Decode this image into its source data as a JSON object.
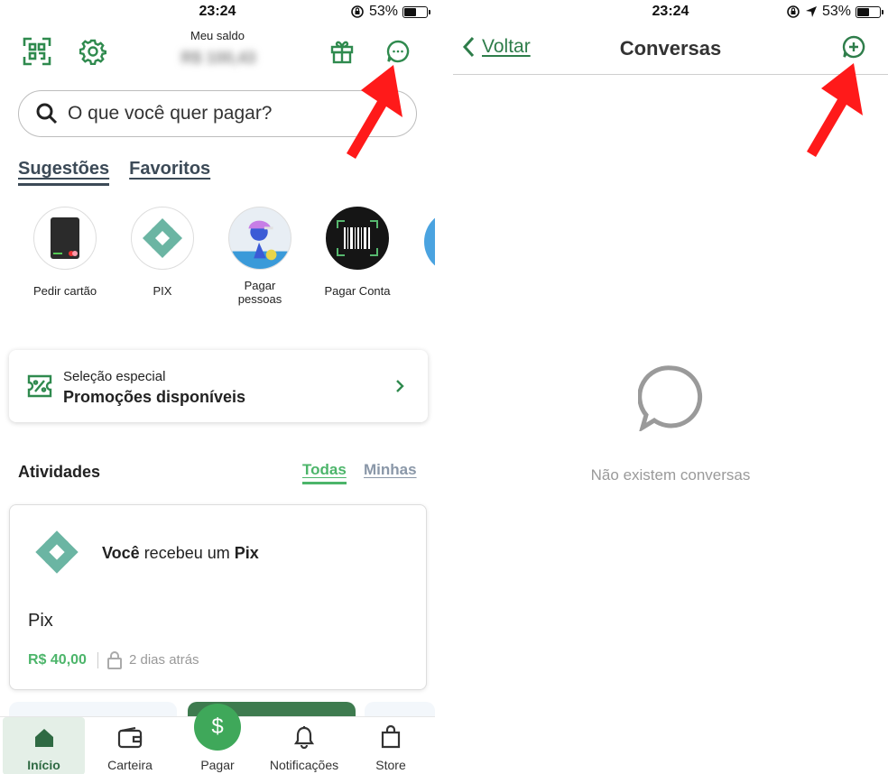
{
  "left": {
    "status": {
      "time": "23:24",
      "battery": "53%"
    },
    "header": {
      "saldo_label": "Meu saldo",
      "saldo_value": "R$ 100,43"
    },
    "search": {
      "placeholder": "O que você quer pagar?"
    },
    "tabs": [
      {
        "label": "Sugestões"
      },
      {
        "label": "Favoritos"
      }
    ],
    "suggestions": [
      {
        "label": "Pedir cartão",
        "icon": "card-icon"
      },
      {
        "label": "PIX",
        "icon": "pix-icon"
      },
      {
        "label": "Pagar pessoas",
        "icon": "person-icon"
      },
      {
        "label": "Pagar Conta",
        "icon": "barcode-icon"
      }
    ],
    "promo": {
      "line1": "Seleção especial",
      "line2": "Promoções disponíveis"
    },
    "activities": {
      "title": "Atividades",
      "tabs": [
        {
          "label": "Todas"
        },
        {
          "label": "Minhas"
        }
      ],
      "card": {
        "msg_bold1": "Você",
        "msg_mid": " recebeu um ",
        "msg_bold2": "Pix",
        "type": "Pix",
        "amount": "R$ 40,00",
        "time": "2 dias atrás"
      }
    },
    "nav": [
      {
        "label": "Início"
      },
      {
        "label": "Carteira"
      },
      {
        "label": "Pagar"
      },
      {
        "label": "Notificações"
      },
      {
        "label": "Store"
      }
    ],
    "colors": {
      "accent": "#3fa85a",
      "dark_green": "#2e7d4a",
      "arrow": "#ff1a1a"
    }
  },
  "right": {
    "status": {
      "time": "23:24",
      "battery": "53%"
    },
    "header": {
      "back_label": "Voltar",
      "title": "Conversas"
    },
    "empty_text": "Não existem conversas"
  }
}
